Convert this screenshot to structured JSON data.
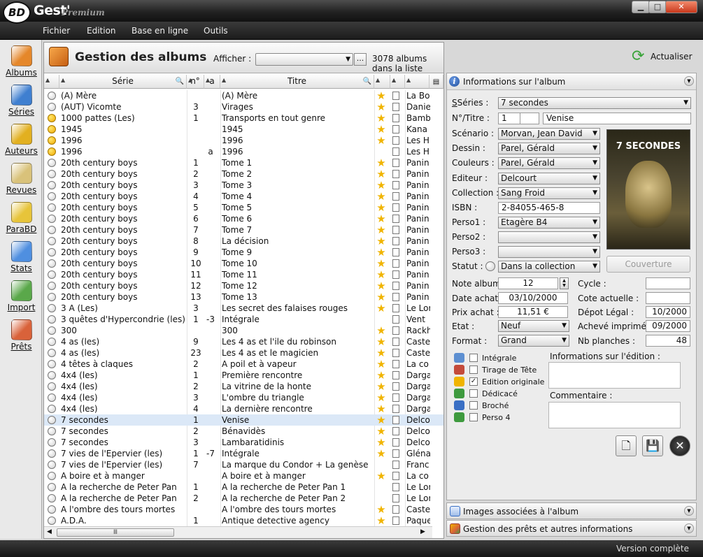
{
  "app": {
    "logo": "BD",
    "name": "Gest'",
    "edition": "Premium"
  },
  "menu": [
    "Fichier",
    "Edition",
    "Base en ligne",
    "Outils"
  ],
  "sidebar": [
    {
      "label": "Albums",
      "icon": "albums-icon",
      "color": "#e5872a"
    },
    {
      "label": "Séries",
      "icon": "series-icon",
      "color": "#3f7fd0"
    },
    {
      "label": "Auteurs",
      "icon": "authors-icon",
      "color": "#e2b020"
    },
    {
      "label": "Revues",
      "icon": "magazines-icon",
      "color": "#d9c27a"
    },
    {
      "label": "ParaBD",
      "icon": "parabd-icon",
      "color": "#e7c43a"
    },
    {
      "label": "Stats",
      "icon": "stats-icon",
      "color": "#4f8fe0"
    },
    {
      "label": "Import",
      "icon": "import-icon",
      "color": "#5aa84a"
    },
    {
      "label": "Prêts",
      "icon": "loans-icon",
      "color": "#d9623a"
    }
  ],
  "main": {
    "title": "Gestion des albums",
    "show_label": "Afficher :",
    "show_value": "",
    "more_button": "...",
    "count": "3078 albums dans la liste",
    "refresh": "Actualiser"
  },
  "grid": {
    "headers": {
      "serie": "Série",
      "num": "n°",
      "a": "a",
      "titre": "Titre"
    },
    "rows": [
      {
        "dot": "w",
        "serie": "(A) Mère",
        "num": "",
        "a": "",
        "titre": "(A) Mère",
        "star": true,
        "editeur": "La Bo"
      },
      {
        "dot": "w",
        "serie": "(AUT) Vicomte",
        "num": "3",
        "a": "",
        "titre": "Virages",
        "star": true,
        "editeur": "Danie"
      },
      {
        "dot": "y",
        "serie": "1000 pattes (Les)",
        "num": "1",
        "a": "",
        "titre": "Transports en tout genre",
        "star": true,
        "editeur": "Bamb"
      },
      {
        "dot": "y",
        "serie": "1945",
        "num": "",
        "a": "",
        "titre": "1945",
        "star": true,
        "editeur": "Kana"
      },
      {
        "dot": "y",
        "serie": "1996",
        "num": "",
        "a": "",
        "titre": "1996",
        "star": true,
        "editeur": "Les H"
      },
      {
        "dot": "y",
        "serie": "1996",
        "num": "",
        "a": "a",
        "titre": "1996",
        "star": false,
        "editeur": "Les H"
      },
      {
        "dot": "w",
        "serie": "20th century boys",
        "num": "1",
        "a": "",
        "titre": "Tome 1",
        "star": true,
        "editeur": "Panin"
      },
      {
        "dot": "w",
        "serie": "20th century boys",
        "num": "2",
        "a": "",
        "titre": "Tome 2",
        "star": true,
        "editeur": "Panin"
      },
      {
        "dot": "w",
        "serie": "20th century boys",
        "num": "3",
        "a": "",
        "titre": "Tome 3",
        "star": true,
        "editeur": "Panin"
      },
      {
        "dot": "w",
        "serie": "20th century boys",
        "num": "4",
        "a": "",
        "titre": "Tome 4",
        "star": true,
        "editeur": "Panin"
      },
      {
        "dot": "w",
        "serie": "20th century boys",
        "num": "5",
        "a": "",
        "titre": "Tome 5",
        "star": true,
        "editeur": "Panin"
      },
      {
        "dot": "w",
        "serie": "20th century boys",
        "num": "6",
        "a": "",
        "titre": "Tome 6",
        "star": true,
        "editeur": "Panin"
      },
      {
        "dot": "w",
        "serie": "20th century boys",
        "num": "7",
        "a": "",
        "titre": "Tome 7",
        "star": true,
        "editeur": "Panin"
      },
      {
        "dot": "w",
        "serie": "20th century boys",
        "num": "8",
        "a": "",
        "titre": "La décision",
        "star": true,
        "editeur": "Panin"
      },
      {
        "dot": "w",
        "serie": "20th century boys",
        "num": "9",
        "a": "",
        "titre": "Tome 9",
        "star": true,
        "editeur": "Panin"
      },
      {
        "dot": "w",
        "serie": "20th century boys",
        "num": "10",
        "a": "",
        "titre": "Tome 10",
        "star": true,
        "editeur": "Panin"
      },
      {
        "dot": "w",
        "serie": "20th century boys",
        "num": "11",
        "a": "",
        "titre": "Tome 11",
        "star": true,
        "editeur": "Panin"
      },
      {
        "dot": "w",
        "serie": "20th century boys",
        "num": "12",
        "a": "",
        "titre": "Tome 12",
        "star": true,
        "editeur": "Panin"
      },
      {
        "dot": "w",
        "serie": "20th century boys",
        "num": "13",
        "a": "",
        "titre": "Tome 13",
        "star": true,
        "editeur": "Panin"
      },
      {
        "dot": "w",
        "serie": "3 A (Les)",
        "num": "3",
        "a": "",
        "titre": "Les secret des falaises rouges",
        "star": true,
        "editeur": "Le Lor"
      },
      {
        "dot": "w",
        "serie": "3 quêtes d'Hypercondrie (les)",
        "num": "1",
        "a": "-3",
        "titre": "Intégrale",
        "star": false,
        "editeur": "Vent"
      },
      {
        "dot": "w",
        "serie": "300",
        "num": "",
        "a": "",
        "titre": "300",
        "star": true,
        "editeur": "Rackh"
      },
      {
        "dot": "w",
        "serie": "4 as (les)",
        "num": "9",
        "a": "",
        "titre": "Les 4 as et l'ile du robinson",
        "star": true,
        "editeur": "Caste"
      },
      {
        "dot": "w",
        "serie": "4 as (les)",
        "num": "23",
        "a": "",
        "titre": "Les 4 as et le magicien",
        "star": true,
        "editeur": "Caste"
      },
      {
        "dot": "w",
        "serie": "4 têtes à claques",
        "num": "2",
        "a": "",
        "titre": "A poil et à vapeur",
        "star": true,
        "editeur": "La co"
      },
      {
        "dot": "w",
        "serie": "4x4 (les)",
        "num": "1",
        "a": "",
        "titre": "Première rencontre",
        "star": true,
        "editeur": "Darga"
      },
      {
        "dot": "w",
        "serie": "4x4 (les)",
        "num": "2",
        "a": "",
        "titre": "La vitrine de la honte",
        "star": true,
        "editeur": "Darga"
      },
      {
        "dot": "w",
        "serie": "4x4 (les)",
        "num": "3",
        "a": "",
        "titre": "L'ombre du triangle",
        "star": true,
        "editeur": "Darga"
      },
      {
        "dot": "w",
        "serie": "4x4 (les)",
        "num": "4",
        "a": "",
        "titre": "La dernière rencontre",
        "star": true,
        "editeur": "Darga"
      },
      {
        "dot": "w",
        "serie": "7 secondes",
        "num": "1",
        "a": "",
        "titre": "Venise",
        "star": true,
        "editeur": "Delco",
        "selected": true
      },
      {
        "dot": "w",
        "serie": "7 secondes",
        "num": "2",
        "a": "",
        "titre": "Bénavidès",
        "star": true,
        "editeur": "Delco"
      },
      {
        "dot": "w",
        "serie": "7 secondes",
        "num": "3",
        "a": "",
        "titre": "Lambaratidinis",
        "star": true,
        "editeur": "Delco"
      },
      {
        "dot": "w",
        "serie": "7 vies de l'Epervier (les)",
        "num": "1",
        "a": "-7",
        "titre": "Intégrale",
        "star": true,
        "editeur": "Glénat"
      },
      {
        "dot": "w",
        "serie": "7 vies de l'Epervier (les)",
        "num": "7",
        "a": "",
        "titre": "La marque du Condor + La genèse",
        "star": false,
        "editeur": "Franc"
      },
      {
        "dot": "w",
        "serie": "A boire et à manger",
        "num": "",
        "a": "",
        "titre": "A boire et à manger",
        "star": true,
        "editeur": "La co"
      },
      {
        "dot": "w",
        "serie": "A la recherche de Peter Pan",
        "num": "1",
        "a": "",
        "titre": "A la recherche de Peter Pan 1",
        "star": false,
        "editeur": "Le Lor"
      },
      {
        "dot": "w",
        "serie": "A la recherche de Peter Pan",
        "num": "2",
        "a": "",
        "titre": "A la recherche de Peter Pan 2",
        "star": false,
        "editeur": "Le Lor"
      },
      {
        "dot": "w",
        "serie": "A l'ombre des tours mortes",
        "num": "",
        "a": "",
        "titre": "A l'ombre des tours mortes",
        "star": true,
        "editeur": "Caste"
      },
      {
        "dot": "w",
        "serie": "A.D.A.",
        "num": "1",
        "a": "",
        "titre": "Antique detective agency",
        "star": true,
        "editeur": "Paque"
      }
    ]
  },
  "panel": {
    "title": "Informations sur l'album",
    "series_label": "Séries :",
    "series_value": "7 secondes",
    "num_title_label": "N°/Titre :",
    "num_value": "1",
    "num2_value": "",
    "title_value": "Venise",
    "scenario_label": "Scénario :",
    "scenario_value": "Morvan, Jean David",
    "dessin_label": "Dessin :",
    "dessin_value": "Parel, Gérald",
    "couleurs_label": "Couleurs :",
    "couleurs_value": "Parel, Gérald",
    "editeur_label": "Editeur :",
    "editeur_value": "Delcourt",
    "collection_label": "Collection :",
    "collection_value": "Sang Froid",
    "isbn_label": "ISBN :",
    "isbn_value": "2-84055-465-8",
    "perso1_label": "Perso1 :",
    "perso1_value": "Etagère B4",
    "perso2_label": "Perso2 :",
    "perso2_value": "",
    "perso3_label": "Perso3 :",
    "perso3_value": "",
    "statut_label": "Statut :",
    "statut_value": "Dans la collection",
    "cover_title": "7 SECONDES",
    "cover_button": "Couverture",
    "note_label": "Note album",
    "note_value": "12",
    "cycle_label": "Cycle :",
    "cycle_value": "",
    "date_label": "Date achat",
    "date_value": "03/10/2000",
    "cote_label": "Cote actuelle :",
    "cote_value": "",
    "prix_label": "Prix achat :",
    "prix_value": "11,51 €",
    "depot_label": "Dépot Légal :",
    "depot_value": "10/2000",
    "etat_label": "Etat :",
    "etat_value": "Neuf",
    "acheve_label": "Achevé imprimé",
    "acheve_value": "09/2000",
    "format_label": "Format :",
    "format_value": "Grand",
    "planches_label": "Nb planches :",
    "planches_value": "48",
    "checks": [
      {
        "label": "Intégrale",
        "checked": false,
        "icon": "layers-icon",
        "color": "#5d8fd1"
      },
      {
        "label": "Tirage de Tête",
        "checked": false,
        "icon": "book-icon",
        "color": "#c44a3a"
      },
      {
        "label": "Edition originale",
        "checked": true,
        "icon": "star-icon",
        "color": "#f0b400"
      },
      {
        "label": "Dédicacé",
        "checked": false,
        "icon": "pencil-icon",
        "color": "#3e9a3e"
      },
      {
        "label": "Broché",
        "checked": false,
        "icon": "booklet-icon",
        "color": "#3a6fc4"
      },
      {
        "label": "Perso 4",
        "checked": false,
        "icon": "pin-icon",
        "color": "#3e9a3e"
      }
    ],
    "edition_info_label": "Informations sur l'édition :",
    "comment_label": "Commentaire :"
  },
  "folds": [
    "Images associées à l'album",
    "Gestion des prêts et autres informations"
  ],
  "status": "Version complète"
}
